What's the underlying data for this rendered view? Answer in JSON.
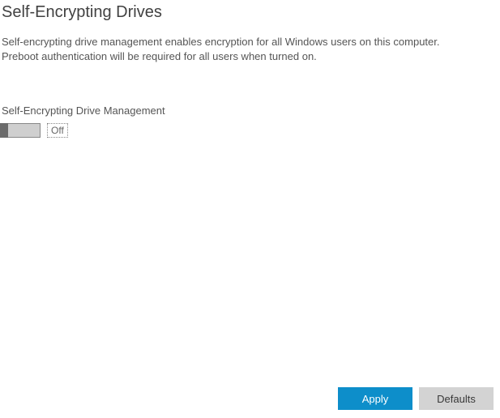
{
  "header": {
    "title": "Self-Encrypting Drives"
  },
  "description": {
    "line1": "Self-encrypting drive management enables encryption for all Windows users on this computer.",
    "line2": "Preboot authentication will be required for all users when turned on."
  },
  "section": {
    "label": "Self-Encrypting Drive Management",
    "toggle_state": "Off"
  },
  "footer": {
    "apply_label": "Apply",
    "defaults_label": "Defaults"
  }
}
